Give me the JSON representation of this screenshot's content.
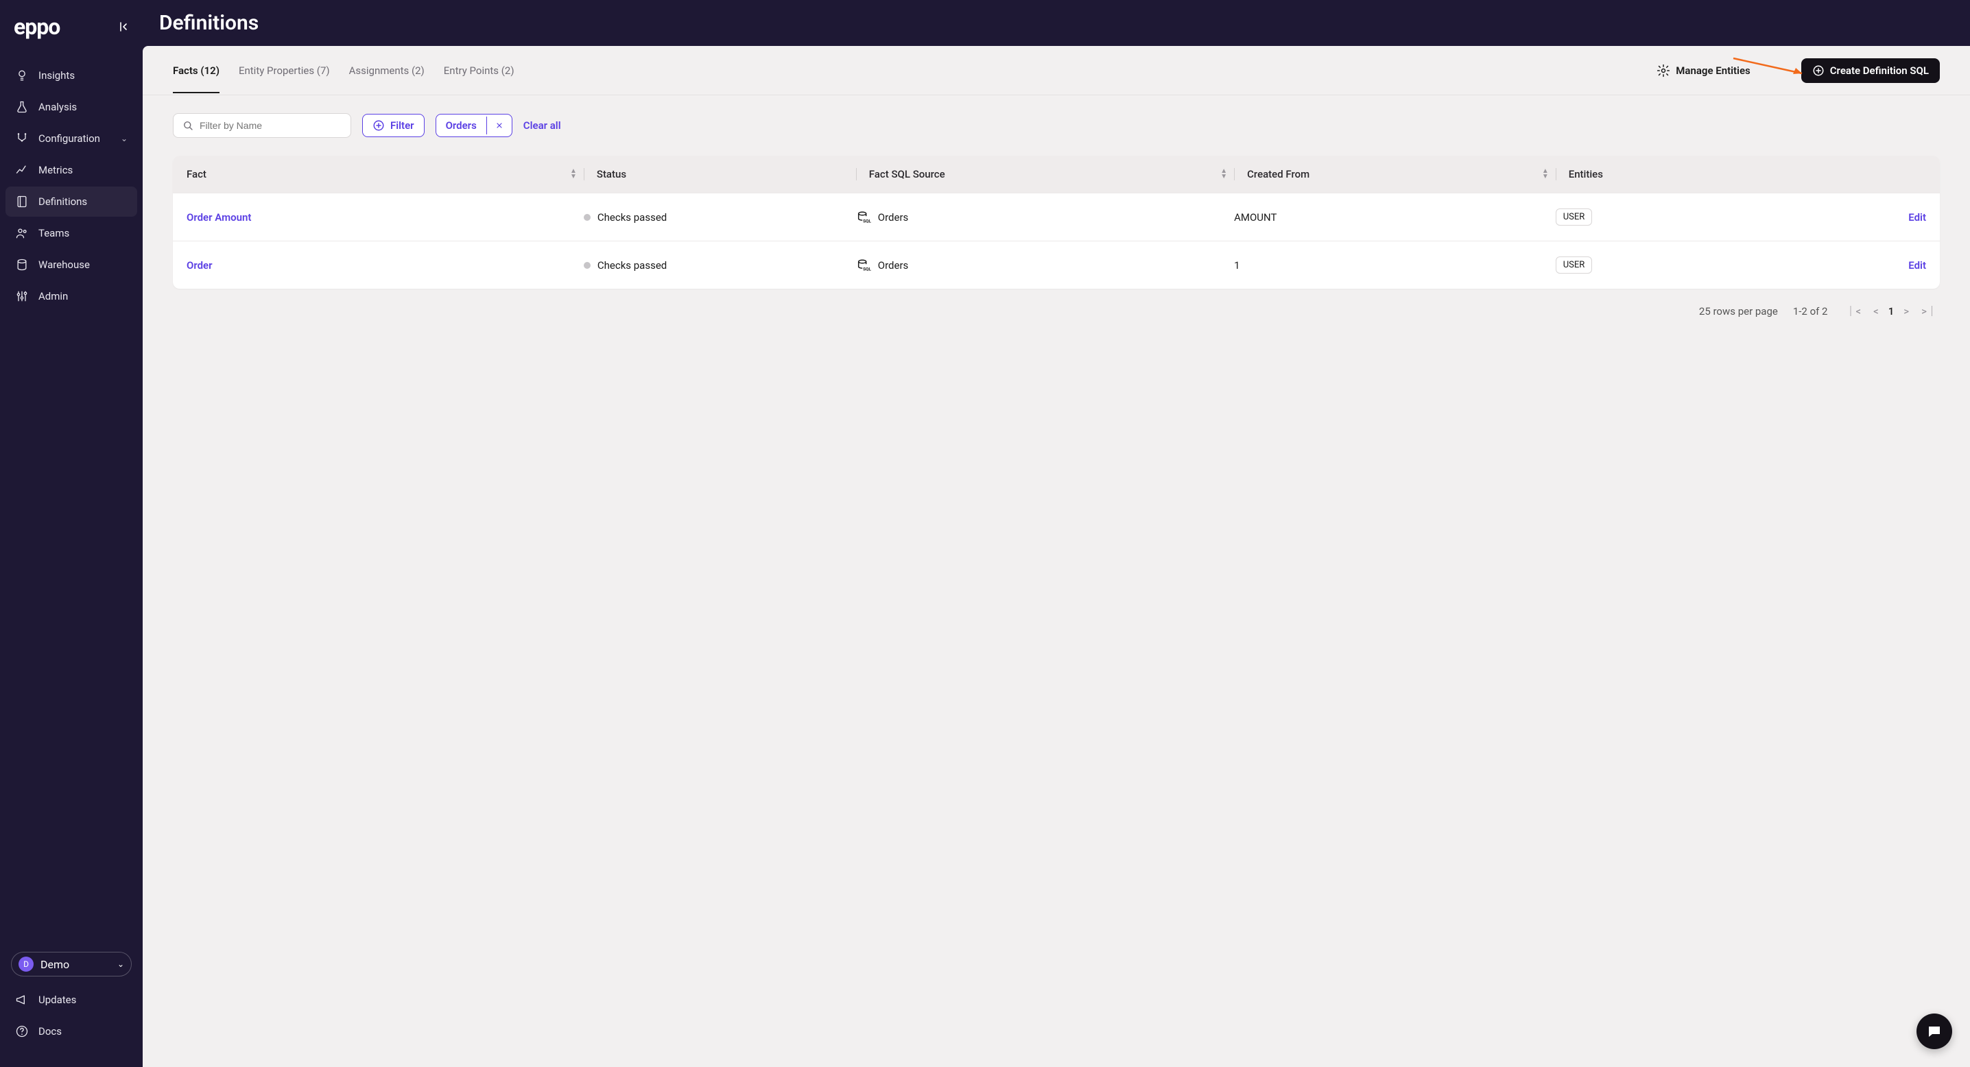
{
  "brand": "eppo",
  "page_title": "Definitions",
  "sidebar": {
    "items": [
      {
        "label": "Insights",
        "icon": "bulb"
      },
      {
        "label": "Analysis",
        "icon": "flask"
      },
      {
        "label": "Configuration",
        "icon": "branch",
        "expandable": true
      },
      {
        "label": "Metrics",
        "icon": "chart"
      },
      {
        "label": "Definitions",
        "icon": "book",
        "active": true
      },
      {
        "label": "Teams",
        "icon": "users"
      },
      {
        "label": "Warehouse",
        "icon": "database"
      },
      {
        "label": "Admin",
        "icon": "sliders"
      }
    ],
    "user": {
      "avatar_letter": "D",
      "name": "Demo"
    },
    "footer": [
      {
        "label": "Updates",
        "icon": "megaphone"
      },
      {
        "label": "Docs",
        "icon": "help"
      }
    ]
  },
  "tabs": [
    {
      "label": "Facts (12)",
      "active": true
    },
    {
      "label": "Entity Properties (7)"
    },
    {
      "label": "Assignments (2)"
    },
    {
      "label": "Entry Points (2)"
    }
  ],
  "actions": {
    "manage_entities": "Manage Entities",
    "create_definition": "Create Definition SQL"
  },
  "filters": {
    "search_placeholder": "Filter by Name",
    "filter_btn": "Filter",
    "chips": [
      {
        "label": "Orders"
      }
    ],
    "clear_all": "Clear all"
  },
  "table": {
    "columns": [
      "Fact",
      "Status",
      "Fact SQL Source",
      "Created From",
      "Entities",
      ""
    ],
    "rows": [
      {
        "fact": "Order Amount",
        "status": "Checks passed",
        "source": "Orders",
        "created_from": "AMOUNT",
        "entity": "USER",
        "edit": "Edit"
      },
      {
        "fact": "Order",
        "status": "Checks passed",
        "source": "Orders",
        "created_from": "1",
        "entity": "USER",
        "edit": "Edit"
      }
    ]
  },
  "pagination": {
    "rows_label": "25 rows per page",
    "range_label": "1-2 of 2",
    "current_page": "1"
  }
}
